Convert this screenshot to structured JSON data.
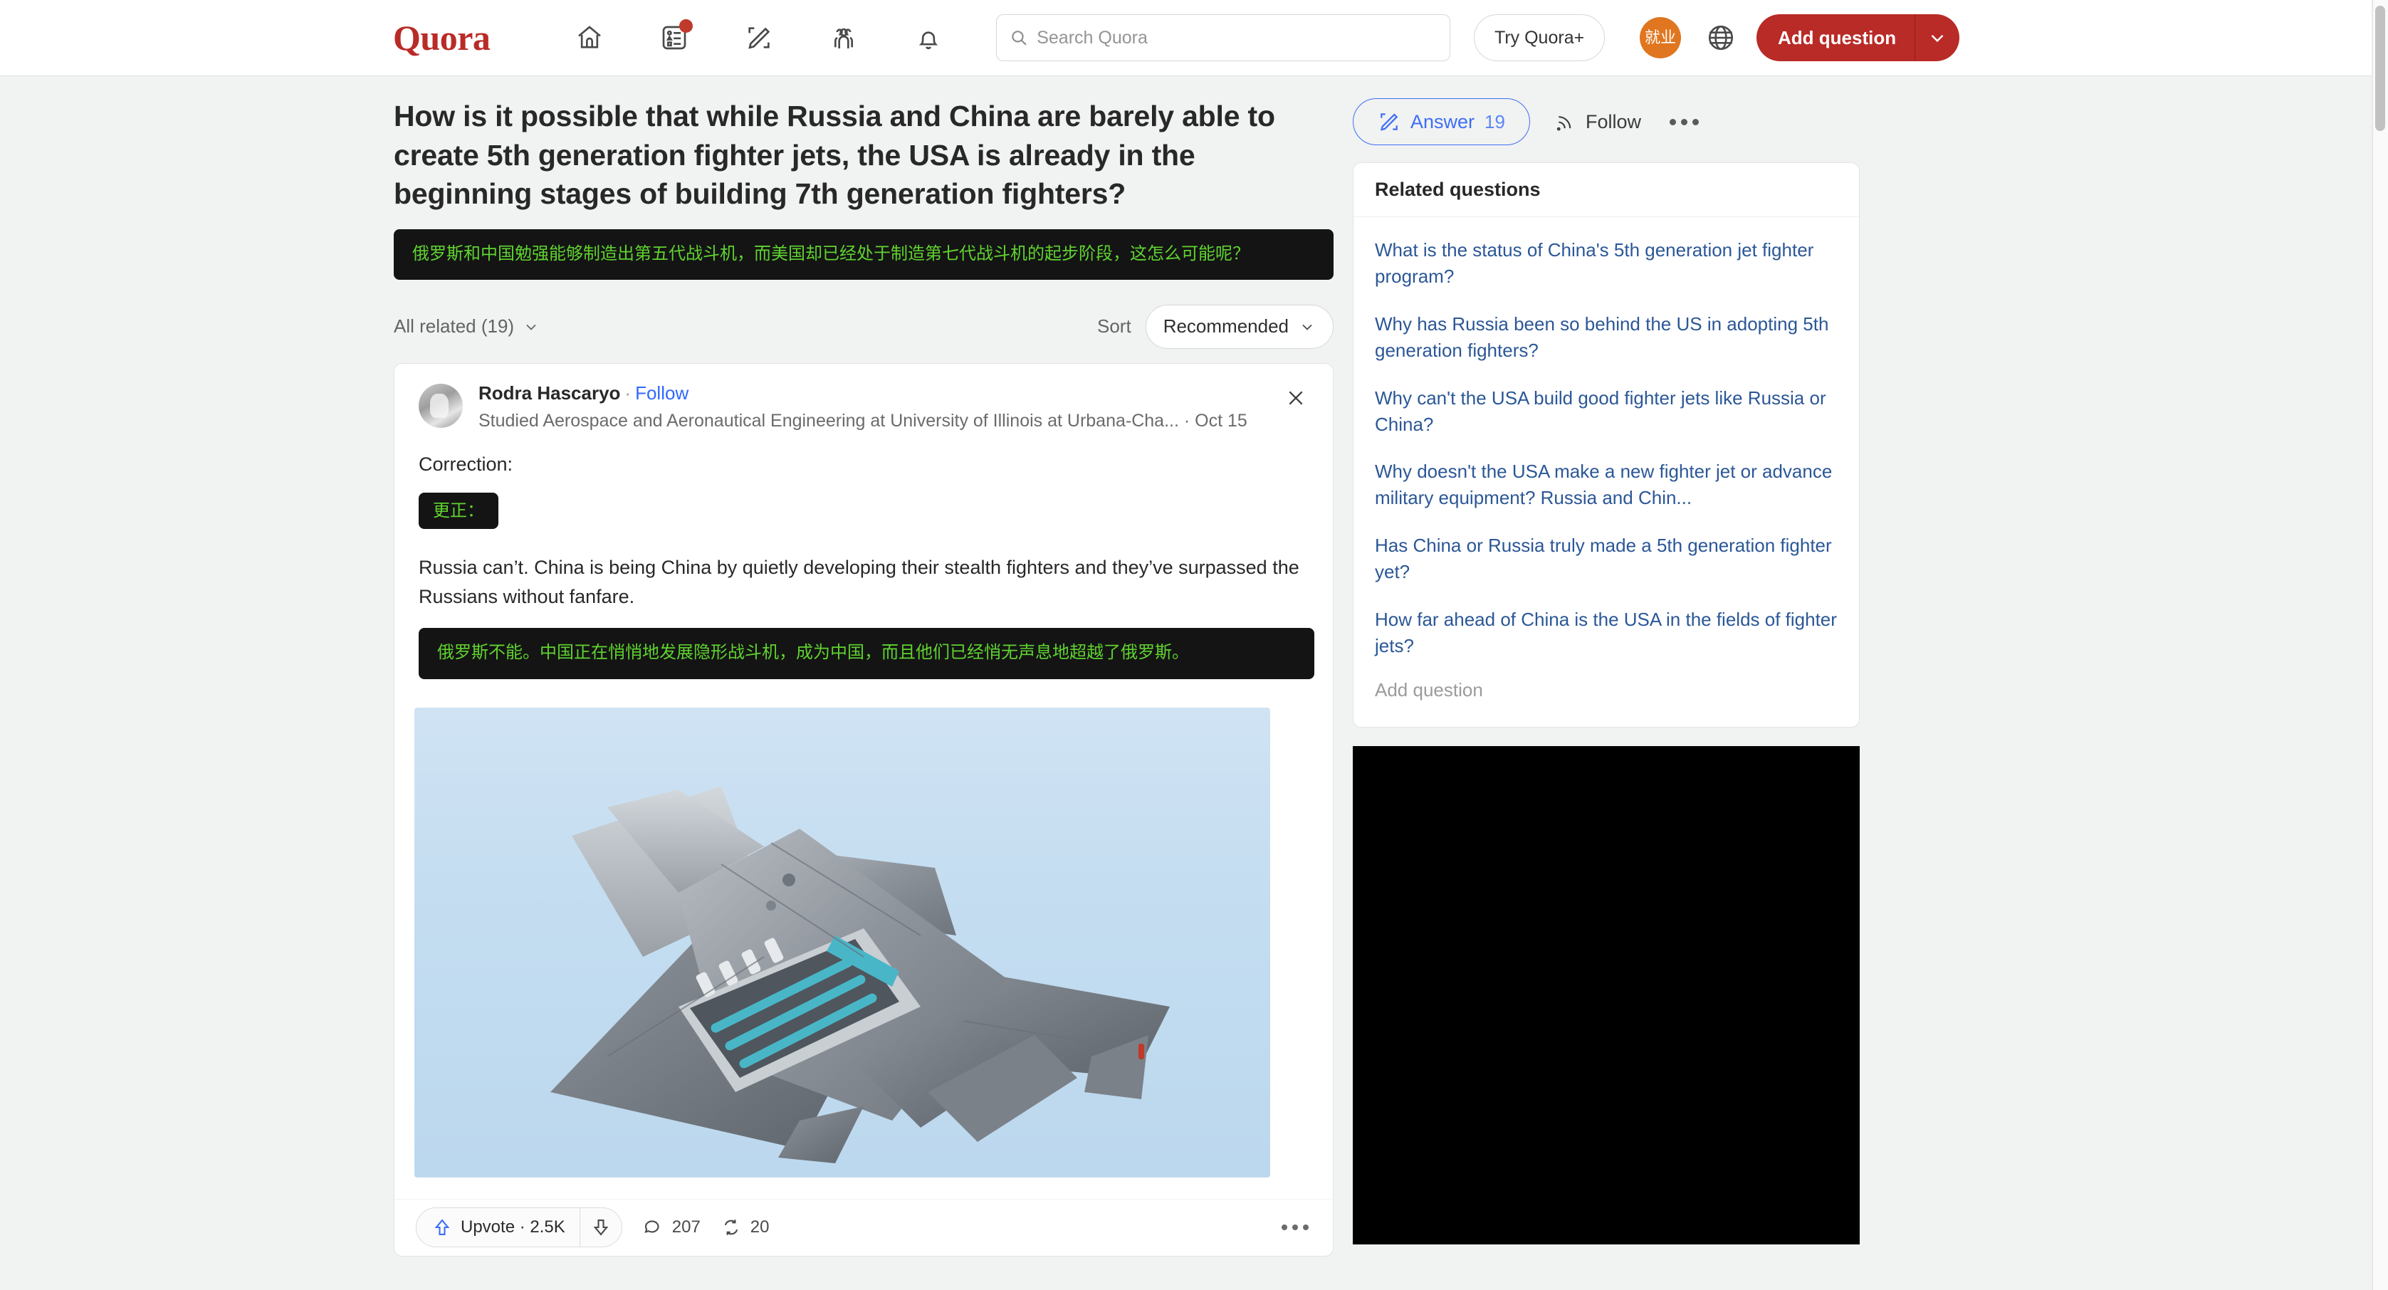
{
  "header": {
    "logo": "Quora",
    "nav": [
      {
        "name": "home-icon",
        "label": "Home"
      },
      {
        "name": "following-icon",
        "label": "Following",
        "badge": true
      },
      {
        "name": "answer-icon",
        "label": "Answer"
      },
      {
        "name": "spaces-icon",
        "label": "Spaces"
      },
      {
        "name": "notifications-icon",
        "label": "Notifications"
      }
    ],
    "search_placeholder": "Search Quora",
    "search_value": "",
    "try_quora_plus": "Try Quora+",
    "profile_avatar_text": "就业",
    "language_icon": "globe-icon",
    "add_question": "Add question",
    "add_question_caret": "chevron-down-icon"
  },
  "question": {
    "title": "How is it possible that while Russia and China are barely able to create 5th generation fighter jets, the USA is already in the beginning stages of building 7th generation fighters?",
    "translation": "俄罗斯和中国勉强能够制造出第五代战斗机，而美国却已经处于制造第七代战斗机的起步阶段，这怎么可能呢？"
  },
  "filters": {
    "all_related": "All related (19)",
    "sort_label": "Sort",
    "sort_value": "Recommended"
  },
  "answer": {
    "author_name": "Rodra Hascaryo",
    "separator": "·",
    "follow": "Follow",
    "credential": "Studied Aerospace and Aeronautical Engineering at University of Illinois at Urbana-Cha...",
    "date_separator": "·",
    "date": "Oct 15",
    "close_icon": "close-icon",
    "paragraph_1": "Correction:",
    "inline_translation_1": "更正：",
    "paragraph_2": "Russia can’t. China is being China by quietly developing their stealth fighters and they’ve surpassed the Russians without fanfare.",
    "translation_2": "俄罗斯不能。中国正在悄悄地发展隐形战斗机，成为中国，而且他们已经悄无声息地超越了俄罗斯。",
    "image_alt": "stealth fighter jet with open weapons bay against blue sky",
    "upvote_label": "Upvote · 2.5K",
    "downvote_icon": "downvote-icon",
    "comment_count": "207",
    "share_count": "20",
    "more_icon": "more-options-icon"
  },
  "sidebar": {
    "answer_button": "Answer",
    "answer_count": "19",
    "follow_button": "Follow",
    "more_icon": "more-options-icon",
    "related_title": "Related questions",
    "related_questions": [
      "What is the status of China's 5th generation jet fighter program?",
      "Why has Russia been so behind the US in adopting 5th generation fighters?",
      "Why can't the USA build good fighter jets like Russia or China?",
      "Why doesn't the USA make a new fighter jet or advance military equipment? Russia and Chin...",
      "Has China or Russia truly made a 5th generation fighter yet?",
      "How far ahead of China is the USA in the fields of fighter jets?"
    ],
    "add_question": "Add question"
  },
  "colors": {
    "brand_red": "#b92b27",
    "link_blue": "#2b5797",
    "accent_blue": "#3d6ff5",
    "translation_green": "#5fd32f",
    "translation_bg": "#141414",
    "page_bg": "#f1f2f2"
  }
}
